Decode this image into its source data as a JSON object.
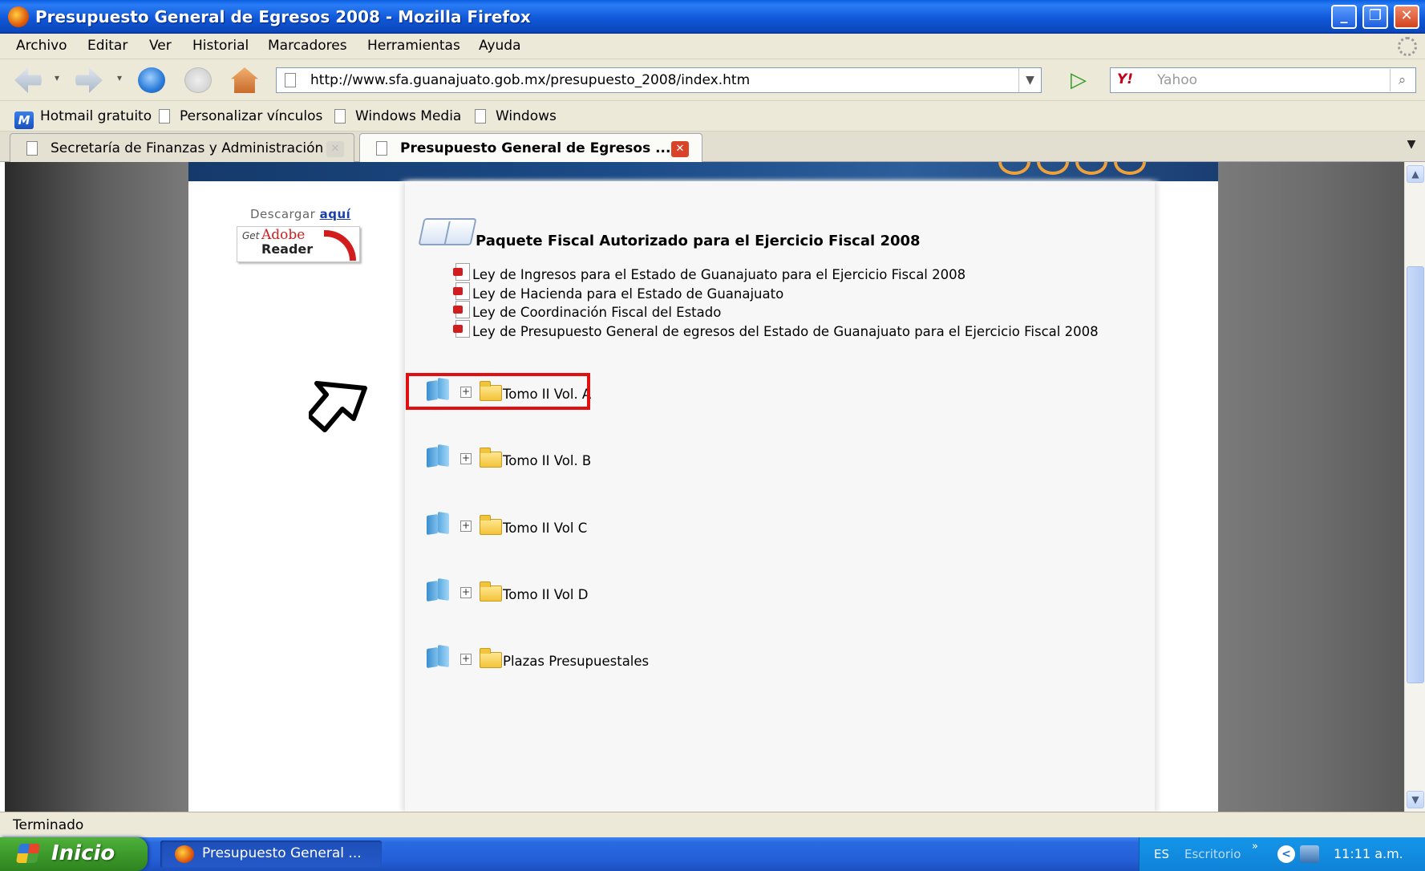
{
  "window": {
    "title": "Presupuesto General de Egresos 2008 - Mozilla Firefox",
    "buttons": {
      "minimize": "_",
      "maximize": "❐",
      "close": "✕"
    }
  },
  "menu": [
    "Archivo",
    "Editar",
    "Ver",
    "Historial",
    "Marcadores",
    "Herramientas",
    "Ayuda"
  ],
  "toolbar": {
    "url": "http://www.sfa.guanajuato.gob.mx/presupuesto_2008/index.htm",
    "search_engine": "Y!",
    "search_placeholder": "Yahoo",
    "icons": [
      "back-icon",
      "forward-icon",
      "reload-icon",
      "stop-icon",
      "home-icon",
      "go-icon",
      "search-icon"
    ]
  },
  "bookmarks": [
    "Hotmail gratuito",
    "Personalizar vínculos",
    "Windows Media",
    "Windows"
  ],
  "tabs": [
    {
      "label": "Secretaría de Finanzas y Administración",
      "active": false
    },
    {
      "label": "Presupuesto General de Egresos ...",
      "active": true
    }
  ],
  "page": {
    "download_prefix": "Descargar",
    "download_link": "aquí",
    "adobe": {
      "get": "Get",
      "brand": "Adobe",
      "product": "Reader"
    },
    "section_title": "Paquete Fiscal Autorizado para el Ejercicio Fiscal 2008",
    "documents": [
      "Ley de Ingresos para el Estado de Guanajuato para el Ejercicio Fiscal 2008",
      "Ley de Hacienda para el Estado de Guanajuato",
      "Ley de Coordinación Fiscal del Estado",
      "Ley de Presupuesto General de egresos del Estado de Guanajuato para el Ejercicio Fiscal 2008"
    ],
    "tree": [
      "Tomo II Vol. A",
      "Tomo II Vol. B",
      "Tomo II Vol C",
      "Tomo II Vol D",
      "Plazas Presupuestales"
    ],
    "highlighted_item": "Tomo II Vol. A"
  },
  "status": "Terminado",
  "taskbar": {
    "start": "Inicio",
    "task": "Presupuesto General ...",
    "lang": "ES",
    "desktop": "Escritorio",
    "clock": "11:11 a.m."
  },
  "colors": {
    "title_blue": "#0f56d6",
    "highlight_red": "#e01010",
    "start_green": "#3c9a2a"
  }
}
